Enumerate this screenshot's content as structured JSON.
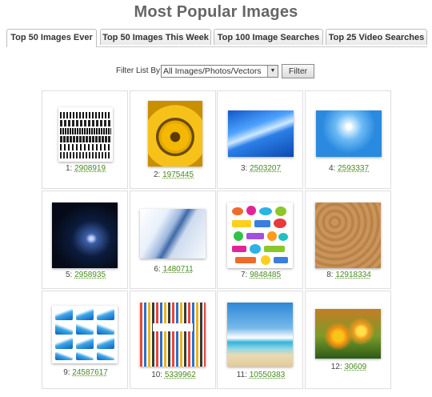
{
  "page": {
    "title": "Most Popular Images"
  },
  "tabs": [
    {
      "label": "Top 50 Images Ever",
      "active": true
    },
    {
      "label": "Top 50 Images This Week",
      "active": false
    },
    {
      "label": "Top 100 Image Searches",
      "active": false
    },
    {
      "label": "Top 25 Video Searches",
      "active": false
    }
  ],
  "filter": {
    "label": "Filter List By:",
    "selected": "All Images/Photos/Vectors",
    "button_label": "Filter"
  },
  "images": [
    {
      "rank": "1:",
      "id": "2908919",
      "subject": "silhouettes"
    },
    {
      "rank": "2:",
      "id": "1975445",
      "subject": "sunflowers"
    },
    {
      "rank": "3:",
      "id": "2503207",
      "subject": "blue-abstract"
    },
    {
      "rank": "4:",
      "id": "2593337",
      "subject": "sky-sun"
    },
    {
      "rank": "5:",
      "id": "2958935",
      "subject": "space-light"
    },
    {
      "rank": "6:",
      "id": "1480711",
      "subject": "blue-swoosh"
    },
    {
      "rank": "7:",
      "id": "9848485",
      "subject": "web-buttons"
    },
    {
      "rank": "8:",
      "id": "12918334",
      "subject": "damask-pattern"
    },
    {
      "rank": "9:",
      "id": "24587617",
      "subject": "wave-banners"
    },
    {
      "rank": "10:",
      "id": "5339962",
      "subject": "people-crowd"
    },
    {
      "rank": "11:",
      "id": "10550383",
      "subject": "beach"
    },
    {
      "rank": "12:",
      "id": "30609",
      "subject": "flowers"
    }
  ]
}
